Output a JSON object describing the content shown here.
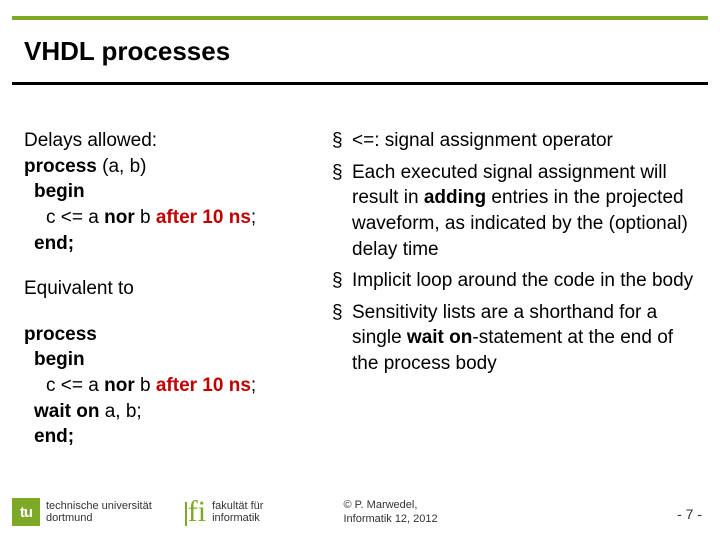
{
  "title": "VHDL processes",
  "left": {
    "intro": "Delays allowed:",
    "p1l1a": "process",
    "p1l1b": " (a, b)",
    "p1l2": "begin",
    "p1l3a": "c <= a ",
    "p1l3b": "nor",
    "p1l3c": " b ",
    "p1l3d": "after 10 ns",
    "p1l3e": ";",
    "p1l4": "end;",
    "equiv": "Equivalent to",
    "p2l1": "process",
    "p2l2": "begin",
    "p2l3a": "c <= a ",
    "p2l3b": "nor",
    "p2l3c": " b ",
    "p2l3d": "after 10 ns",
    "p2l3e": ";",
    "p2l4a": "wait on",
    "p2l4b": " a, b;",
    "p2l5": "end;"
  },
  "bullets": {
    "b1": "<=: signal assignment operator",
    "b2a": "Each executed signal assignment will result in ",
    "b2b": "adding",
    "b2c": " entries in the projected waveform, as indicated by the (optional) delay time",
    "b3": "Implicit loop around the code in the body",
    "b4a": "Sensitivity lists are a shorthand for a single ",
    "b4b": "wait on",
    "b4c": "-statement at the end of the process body"
  },
  "footer": {
    "tu_mark": "tu",
    "tu_line1": "technische universität",
    "tu_line2": "dortmund",
    "fi_mark": "fi",
    "fi_line1": "fakultät für",
    "fi_line2": "informatik",
    "copy_line1": "© P. Marwedel,",
    "copy_line2": "Informatik 12,   2012",
    "pagenum": "-  7 -"
  }
}
